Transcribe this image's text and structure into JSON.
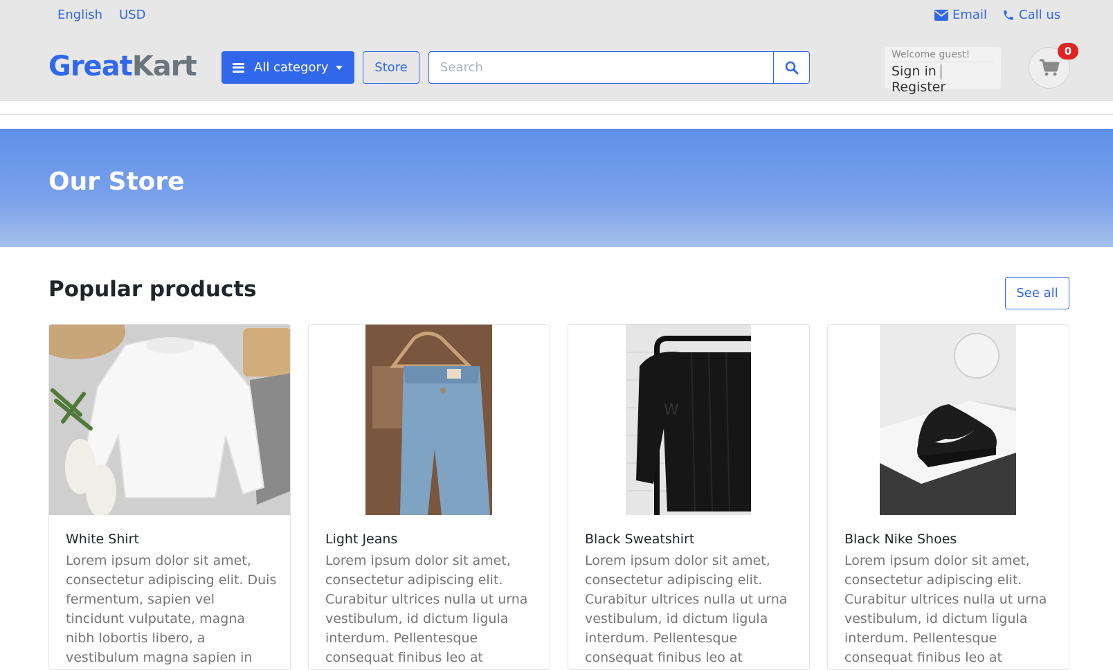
{
  "topbar": {
    "language": "English",
    "currency": "USD",
    "email_label": "Email",
    "call_label": "Call us"
  },
  "header": {
    "logo_part1": "Great",
    "logo_part2": "Kart",
    "category_button": "All category",
    "store_button": "Store",
    "search_placeholder": "Search",
    "welcome_text": "Welcome guest!",
    "sign_in": "Sign in",
    "register": "Register",
    "cart_count": "0"
  },
  "banner": {
    "title": "Our Store"
  },
  "section": {
    "title": "Popular products",
    "see_all": "See all"
  },
  "products": [
    {
      "name": "White Shirt",
      "description": "Lorem ipsum dolor sit amet, consectetur adipiscing elit. Duis fermentum, sapien vel tincidunt vulputate, magna nibh lobortis libero, a vestibulum magna sapien in risus."
    },
    {
      "name": "Light Jeans",
      "description": "Lorem ipsum dolor sit amet, consectetur adipiscing elit. Curabitur ultrices nulla ut urna vestibulum, id dictum ligula interdum. Pellentesque consequat finibus leo at vehicula."
    },
    {
      "name": "Black Sweatshirt",
      "description": "Lorem ipsum dolor sit amet, consectetur adipiscing elit. Curabitur ultrices nulla ut urna vestibulum, id dictum ligula interdum. Pellentesque consequat finibus leo at vehicula."
    },
    {
      "name": "Black Nike Shoes",
      "description": "Lorem ipsum dolor sit amet, consectetur adipiscing elit. Curabitur ultrices nulla ut urna vestibulum, id dictum ligula interdum. Pellentesque consequat finibus leo at vehicula."
    }
  ],
  "colors": {
    "primary": "#3167eb",
    "badge": "#e02424"
  }
}
